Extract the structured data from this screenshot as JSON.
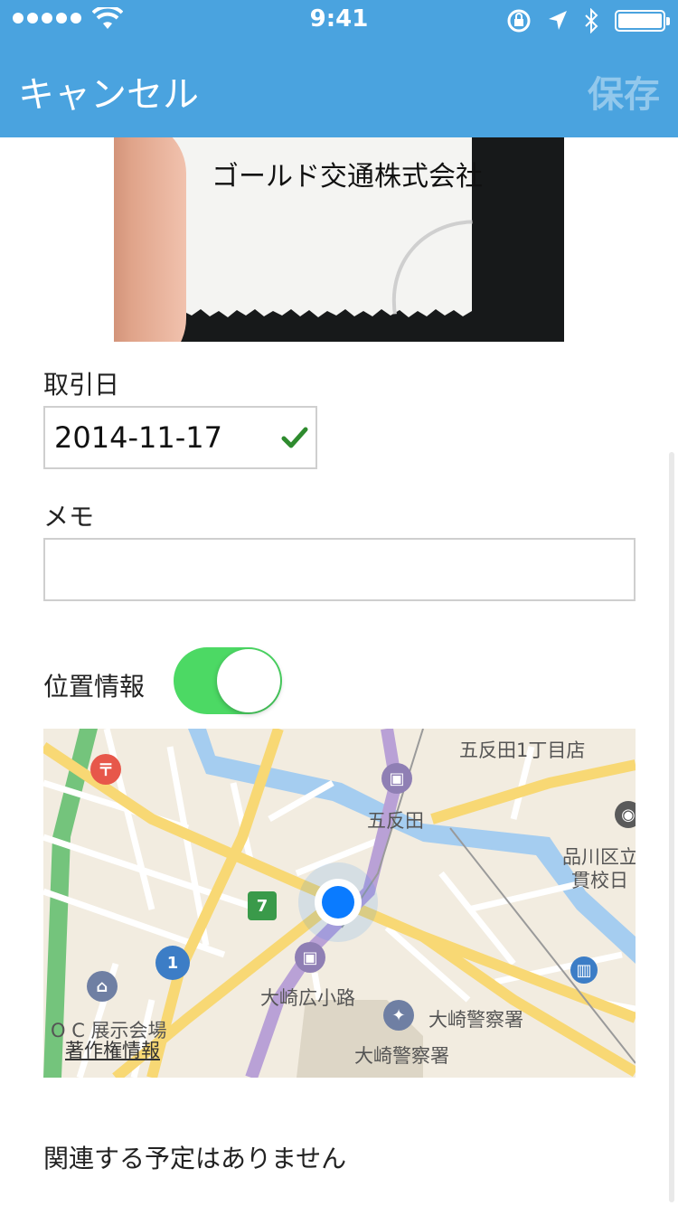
{
  "status_bar": {
    "time": "9:41"
  },
  "nav": {
    "cancel_label": "キャンセル",
    "save_label": "保存"
  },
  "receipt": {
    "company_text": "ゴールド交通株式会社"
  },
  "form": {
    "date_label": "取引日",
    "date_value": "2014-11-17",
    "memo_label": "メモ",
    "memo_value": "",
    "location_label": "位置情報",
    "location_enabled": true
  },
  "map": {
    "labels": [
      "五反田1丁目店",
      "五反田",
      "品川区立",
      "貫校日",
      "大崎広小路",
      "大崎警察署",
      "大崎警察署",
      "O C 展示会場"
    ],
    "highway_number": "1",
    "copyright_label": "著作権情報"
  },
  "footer": {
    "no_events_text": "関連する予定はありません"
  },
  "colors": {
    "accent": "#4aa3df",
    "toggle_on": "#4cd964",
    "check": "#2e8b2e",
    "user_location": "#0a7bff"
  }
}
